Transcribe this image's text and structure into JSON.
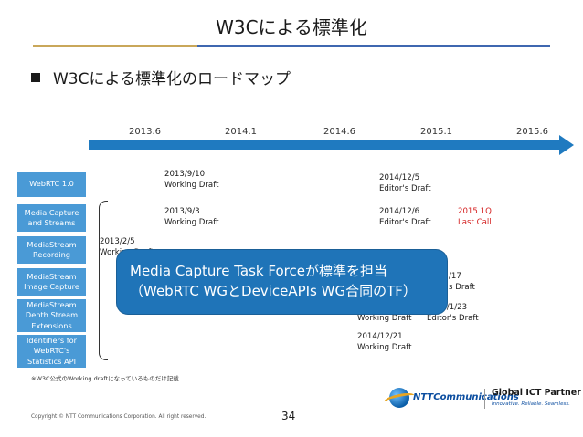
{
  "title": "W3Cによる標準化",
  "bullet": "W3Cによる標準化のロードマップ",
  "timeline": {
    "years": [
      "2013.6",
      "2014.1",
      "2014.6",
      "2015.1",
      "2015.6"
    ]
  },
  "specs": [
    "WebRTC 1.0",
    "Media Capture and Streams",
    "MediaStream Recording",
    "MediaStream Image Capture",
    "MediaStream Depth Stream Extensions",
    "Identifiers for WebRTC's Statistics API"
  ],
  "events": {
    "e1": "2013/9/10\nWorking Draft",
    "e2": "2014/12/5\nEditor's Draft",
    "e3": "2013/9/3\nWorking Draft",
    "e4": "2014/12/6\nEditor's Draft",
    "e5": "2015 1Q\nLast Call",
    "e6": "2013/2/5\nWorking Draft",
    "e7": "/17\ns Draft",
    "e8": "2014/10/7\nWorking Draft",
    "e9": "2015/1/23\nEditor's Draft",
    "e10": "2014/12/21\nWorking Draft"
  },
  "callout": {
    "line1": "Media Capture Task Forceが標準を担当",
    "line2": "（WebRTC WGとDeviceAPIs WG合同のTF）"
  },
  "note": "※W3C公式のWorking draftになっているものだけ記載",
  "copyright": "Copyright © NTT Communications Corporation. All right reserved.",
  "page_number": "34",
  "logo": {
    "company": "NTTCommunications",
    "partner": "Global ICT Partner",
    "tagline": "Innovative. Reliable. Seamless."
  },
  "colors": {
    "arrow": "#1f7ac0",
    "spec_box": "#4a9ad6",
    "callout": "#1f74b8",
    "highlight_text": "#d41e1e"
  }
}
